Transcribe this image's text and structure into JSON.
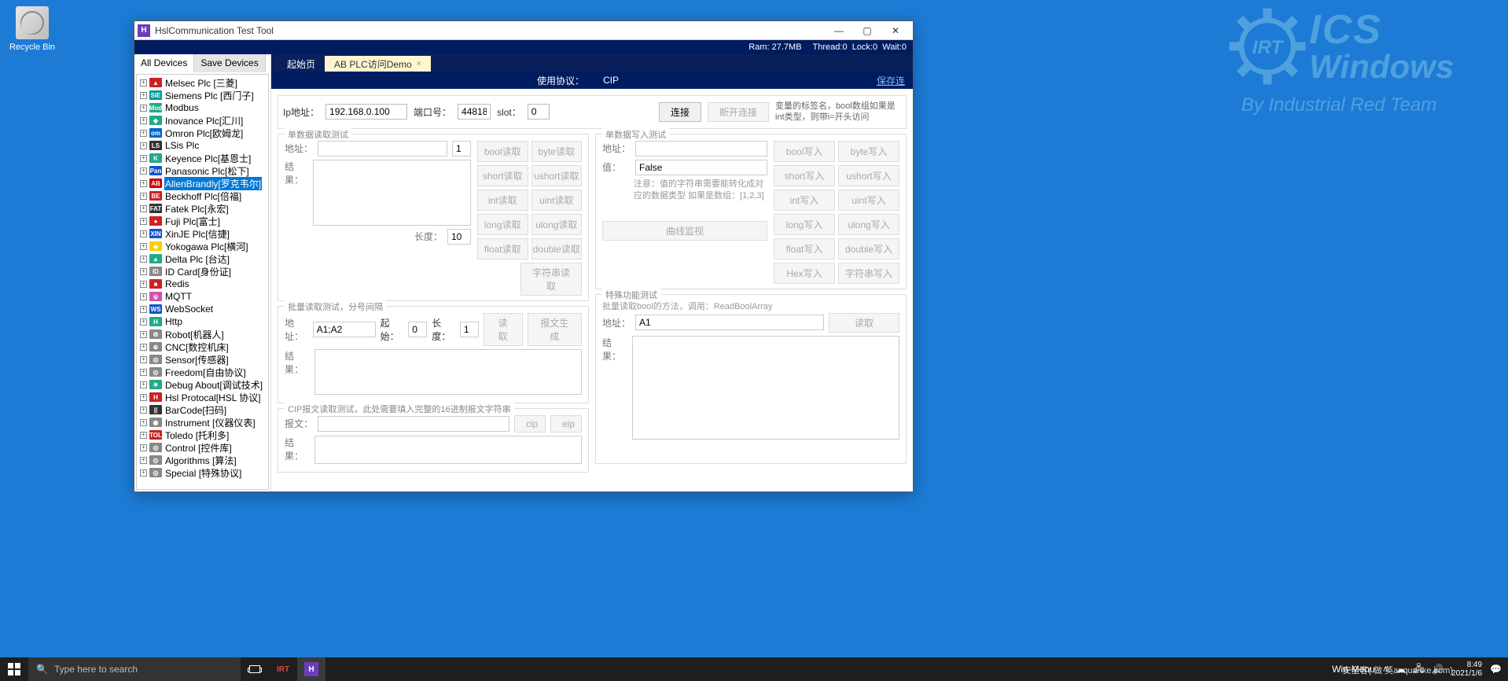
{
  "desktop": {
    "recycle_bin": "Recycle Bin"
  },
  "watermark": {
    "l1": "ICS",
    "l2": "Windows",
    "by": "By Industrial Red Team",
    "gear_text": "IRT"
  },
  "window": {
    "title": "HslCommunication Test Tool",
    "status": {
      "ram": "Ram: 27.7MB",
      "thread": "Thread:0",
      "lock": "Lock:0",
      "wait": "Wait:0"
    },
    "side_tabs": {
      "all": "All Devices",
      "save": "Save Devices"
    },
    "tree": [
      {
        "icon_bg": "#cc2222",
        "icon_txt": "▲",
        "label": "Melsec Plc [三菱]"
      },
      {
        "icon_bg": "#009999",
        "icon_txt": "SIE",
        "label": "Siemens Plc [西门子]"
      },
      {
        "icon_bg": "#2a8",
        "icon_txt": "Mod",
        "label": "Modbus"
      },
      {
        "icon_bg": "#2a8",
        "icon_txt": "◈",
        "label": "Inovance Plc[汇川]"
      },
      {
        "icon_bg": "#0066cc",
        "icon_txt": "om",
        "label": "Omron Plc[欧姆龙]"
      },
      {
        "icon_bg": "#333",
        "icon_txt": "LS",
        "label": "LSis Plc"
      },
      {
        "icon_bg": "#2a8",
        "icon_txt": "K",
        "label": "Keyence Plc[基恩士]"
      },
      {
        "icon_bg": "#1155cc",
        "icon_txt": "Pan",
        "label": "Panasonic Plc[松下]"
      },
      {
        "icon_bg": "#cc0000",
        "icon_txt": "AB",
        "label": "AllenBrandly[罗克韦尔]",
        "selected": true
      },
      {
        "icon_bg": "#cc2222",
        "icon_txt": "BE",
        "label": "Beckhoff Plc[倍福]"
      },
      {
        "icon_bg": "#333",
        "icon_txt": "FAT",
        "label": "Fatek Plc[永宏]"
      },
      {
        "icon_bg": "#cc2222",
        "icon_txt": "●",
        "label": "Fuji Plc[富士]"
      },
      {
        "icon_bg": "#1155cc",
        "icon_txt": "XIN",
        "label": "XinJE Plc[信捷]"
      },
      {
        "icon_bg": "#ffcc00",
        "icon_txt": "◆",
        "label": "Yokogawa Plc[横河]"
      },
      {
        "icon_bg": "#2a8",
        "icon_txt": "▲",
        "label": "Delta Plc [台达]"
      },
      {
        "icon_bg": "#888",
        "icon_txt": "ID",
        "label": "ID Card[身份证]"
      },
      {
        "icon_bg": "#cc2222",
        "icon_txt": "■",
        "label": "Redis"
      },
      {
        "icon_bg": "#cc55aa",
        "icon_txt": "ψ",
        "label": "MQTT"
      },
      {
        "icon_bg": "#1155cc",
        "icon_txt": "WS",
        "label": "WebSocket"
      },
      {
        "icon_bg": "#2a8",
        "icon_txt": "H",
        "label": "Http"
      },
      {
        "icon_bg": "#888",
        "icon_txt": "⚙",
        "label": "Robot[机器人]"
      },
      {
        "icon_bg": "#888",
        "icon_txt": "⊕",
        "label": "CNC[数控机床]"
      },
      {
        "icon_bg": "#888",
        "icon_txt": "◎",
        "label": "Sensor[传感器]"
      },
      {
        "icon_bg": "#888",
        "icon_txt": "◎",
        "label": "Freedom[自由协议]"
      },
      {
        "icon_bg": "#2a8",
        "icon_txt": "✳",
        "label": "Debug About[调试技术]"
      },
      {
        "icon_bg": "#cc2222",
        "icon_txt": "H",
        "label": "Hsl Protocal[HSL 协议]"
      },
      {
        "icon_bg": "#333",
        "icon_txt": "||",
        "label": "BarCode[扫码]"
      },
      {
        "icon_bg": "#888",
        "icon_txt": "◉",
        "label": "Instrument [仪器仪表]"
      },
      {
        "icon_bg": "#cc2222",
        "icon_txt": "TOL",
        "label": "Toledo [托利多]"
      },
      {
        "icon_bg": "#888",
        "icon_txt": "◎",
        "label": "Control [控件库]"
      },
      {
        "icon_bg": "#888",
        "icon_txt": "◎",
        "label": "Algorithms [算法]"
      },
      {
        "icon_bg": "#888",
        "icon_txt": "◎",
        "label": "Special [特殊协议]"
      }
    ],
    "tabs": {
      "start": "起始页",
      "ab": "AB PLC访问Demo"
    },
    "protocol": {
      "label": "使用协议：",
      "value": "CIP",
      "save": "保存连"
    },
    "conn": {
      "ip_label": "Ip地址：",
      "ip": "192.168.0.100",
      "port_label": "端口号：",
      "port": "44818",
      "slot_label": "slot：",
      "slot": "0",
      "connect": "连接",
      "disconnect": "断开连接",
      "hint": "变量的标签名，bool数组如果是int类型，则带i=开头访问"
    },
    "single_read": {
      "legend": "单数据读取测试",
      "addr_label": "地址：",
      "addr": "",
      "count": "1",
      "result_label": "结果：",
      "len_label": "长度：",
      "len": "10",
      "btns": [
        "bool读取",
        "byte读取",
        "short读取",
        "ushort读取",
        "int读取",
        "uint读取",
        "long读取",
        "ulong读取",
        "float读取",
        "double读取"
      ],
      "strbtn": "字符串读取"
    },
    "single_write": {
      "legend": "单数据写入测试",
      "addr_label": "地址：",
      "addr": "",
      "val_label": "值：",
      "val": "False",
      "note": "注意：值的字符串需要能转化成对应的数据类型 如果是数组：[1,2,3]",
      "curve": "曲线监视",
      "btns": [
        "bool写入",
        "byte写入",
        "short写入",
        "ushort写入",
        "int写入",
        "uint写入",
        "long写入",
        "ulong写入",
        "float写入",
        "double写入",
        "Hex写入",
        "字符串写入"
      ]
    },
    "batch_read": {
      "legend": "批量读取测试，分号间隔",
      "addr_label": "地址：",
      "addr": "A1;A2",
      "start_label": "起始：",
      "start": "0",
      "len_label": "长度：",
      "len": "1",
      "read": "读取",
      "gen": "报文生成",
      "result_label": "结果："
    },
    "cip": {
      "legend": "CIP报文读取测试，此处需要填入完整的16进制报文字符串",
      "msg_label": "报文：",
      "cip": "cip",
      "eip": "eip",
      "result_label": "结果："
    },
    "special": {
      "legend": "特殊功能测试",
      "note": "批量读取bool的方法，调用：ReadBoolArray",
      "addr_label": "地址：",
      "addr": "A1",
      "read": "读取",
      "result_label": "结果："
    }
  },
  "taskbar": {
    "search_placeholder": "Type here to search",
    "winmenu": "Win-Menu",
    "clock": {
      "time": "8:49",
      "date": "2021/1/6"
    },
    "overlay": "安全客( 做 英anquanke.com)"
  }
}
